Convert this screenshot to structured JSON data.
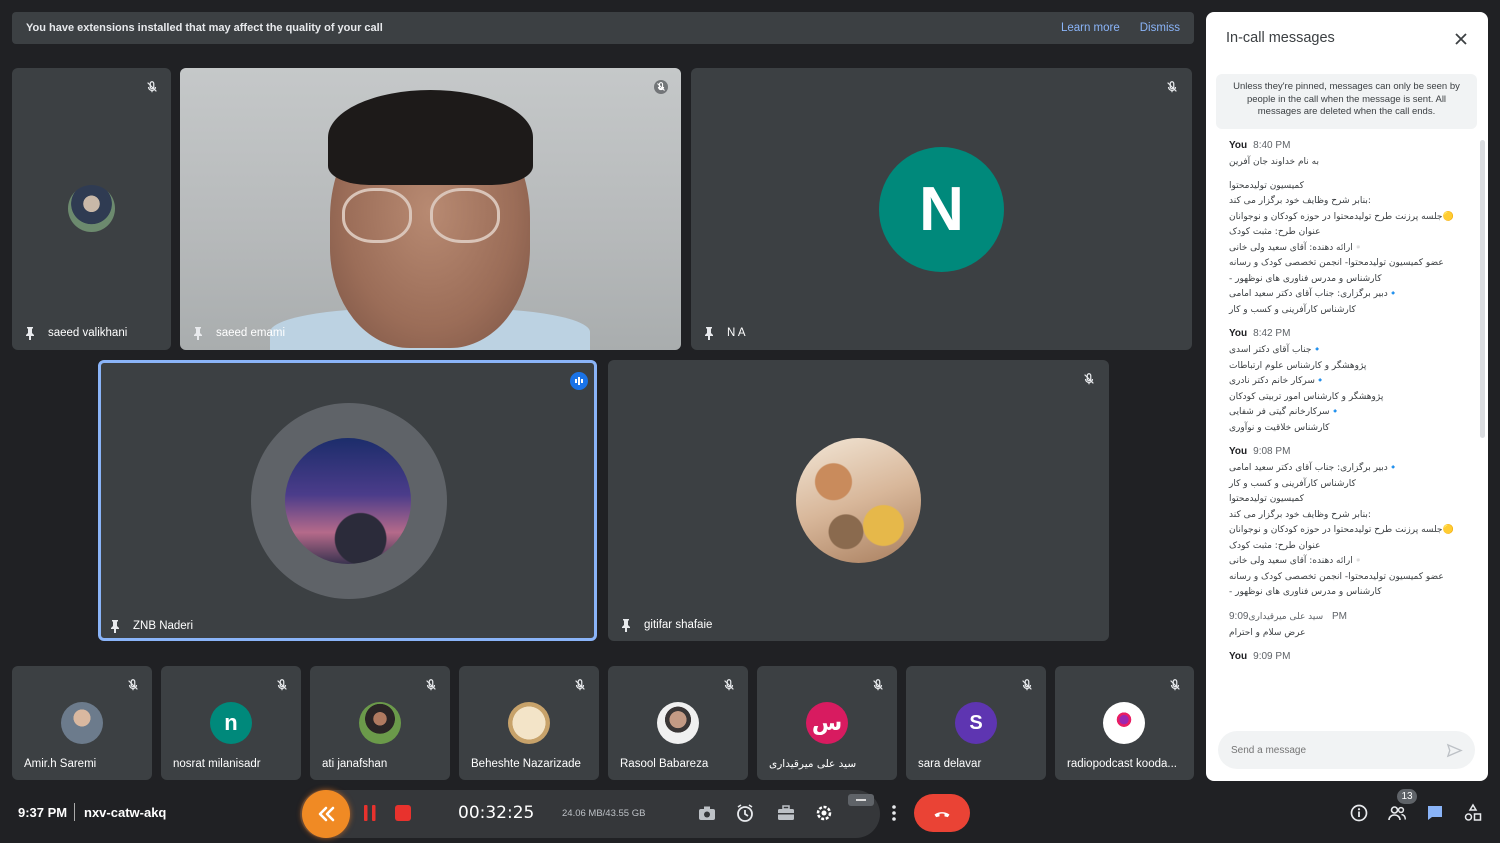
{
  "banner": {
    "message": "You have extensions installed that may affect the quality of your call",
    "learn_more": "Learn more",
    "dismiss": "Dismiss"
  },
  "tiles": {
    "top": [
      {
        "name": "saeed valikhani"
      },
      {
        "name": "saeed emami"
      },
      {
        "name": "N A",
        "initial": "N",
        "color": "#00897b"
      }
    ],
    "middle": [
      {
        "name": "ZNB Naderi",
        "speaking": true
      },
      {
        "name": "gitifar shafaie"
      }
    ],
    "strip": [
      {
        "name": "Amir.h Saremi"
      },
      {
        "name": "nosrat milanisadr",
        "initial": "n",
        "color": "#00897b"
      },
      {
        "name": "ati janafshan"
      },
      {
        "name": "Beheshte Nazarizade"
      },
      {
        "name": "Rasool Babareza"
      },
      {
        "name": "سید علی میرقیداری",
        "initial": "س",
        "color": "#d81b60"
      },
      {
        "name": "sara delavar",
        "initial": "S",
        "color": "#5e35b1"
      },
      {
        "name": "radiopodcast kooda..."
      }
    ]
  },
  "bottom": {
    "time": "9:37 PM",
    "meeting_code": "nxv-catw-akq",
    "timer": "00:32:25",
    "storage": "24.06 MB/43.55 GB",
    "participants_count": "13"
  },
  "chat": {
    "title": "In-call messages",
    "notice": "Unless they're pinned, messages can only be seen by people in the call when the message is sent. All messages are deleted when the call ends.",
    "input_placeholder": "Send a message",
    "groups": [
      {
        "sender": "You",
        "time": "8:40 PM",
        "lines": [
          "به نام خداوند جان آفرین",
          "",
          "کمیسیون تولیدمحتوا",
          "بنابر شرح وظایف خود برگزار می کند:",
          "جلسه پرزنت طرح تولیدمحتوا در حوزه کودکان و نوجوانان🟡",
          "عنوان طرح: مثبت کودک",
          "ارائه دهنده: آقای سعید ولی خانی▫️",
          "عضو کمیسیون تولیدمحتوا- انجمن تخصصی کودک و رسانه",
          "- کارشناس و مدرس فناوری های نوظهور",
          "دبیر برگزاری: جناب آقای دکتر سعید امامی🔹",
          "کارشناس کارآفرینی و کسب و کار"
        ]
      },
      {
        "sender": "You",
        "time": "8:42 PM",
        "lines": [
          "جناب آقای دکتر اسدی🔹",
          "پژوهشگر و کارشناس علوم ارتباطات",
          "سرکار خانم دکتر نادری🔹",
          "پژوهشگر و کارشناس امور تربیتی کودکان",
          "سرکار‌خانم گیتی فر شفایی🔹",
          "کارشناس خلاقیت و نوآوری"
        ]
      },
      {
        "sender": "You",
        "time": "9:08 PM",
        "lines": [
          "دبیر برگزاری: جناب آقای دکتر سعید امامی🔹",
          "کارشناس کارآفرینی و کسب و کار",
          "کمیسیون تولیدمحتوا",
          "بنابر شرح وظایف خود برگزار می کند:",
          "جلسه پرزنت طرح تولیدمحتوا در حوزه کودکان و نوجوانان🟡",
          "عنوان طرح: مثبت کودک",
          "ارائه دهنده: آقای سعید ولی خانی▫️",
          "عضو کمیسیون تولیدمحتوا- انجمن تخصصی کودک و رسانه",
          "- کارشناس و مدرس فناوری های نوظهور"
        ]
      },
      {
        "sender": "سید علی میرقیداری",
        "time": "9:09 PM",
        "lines": [
          "عرض سلام و احترام"
        ]
      },
      {
        "sender": "You",
        "time": "9:09 PM",
        "lines": []
      }
    ]
  }
}
